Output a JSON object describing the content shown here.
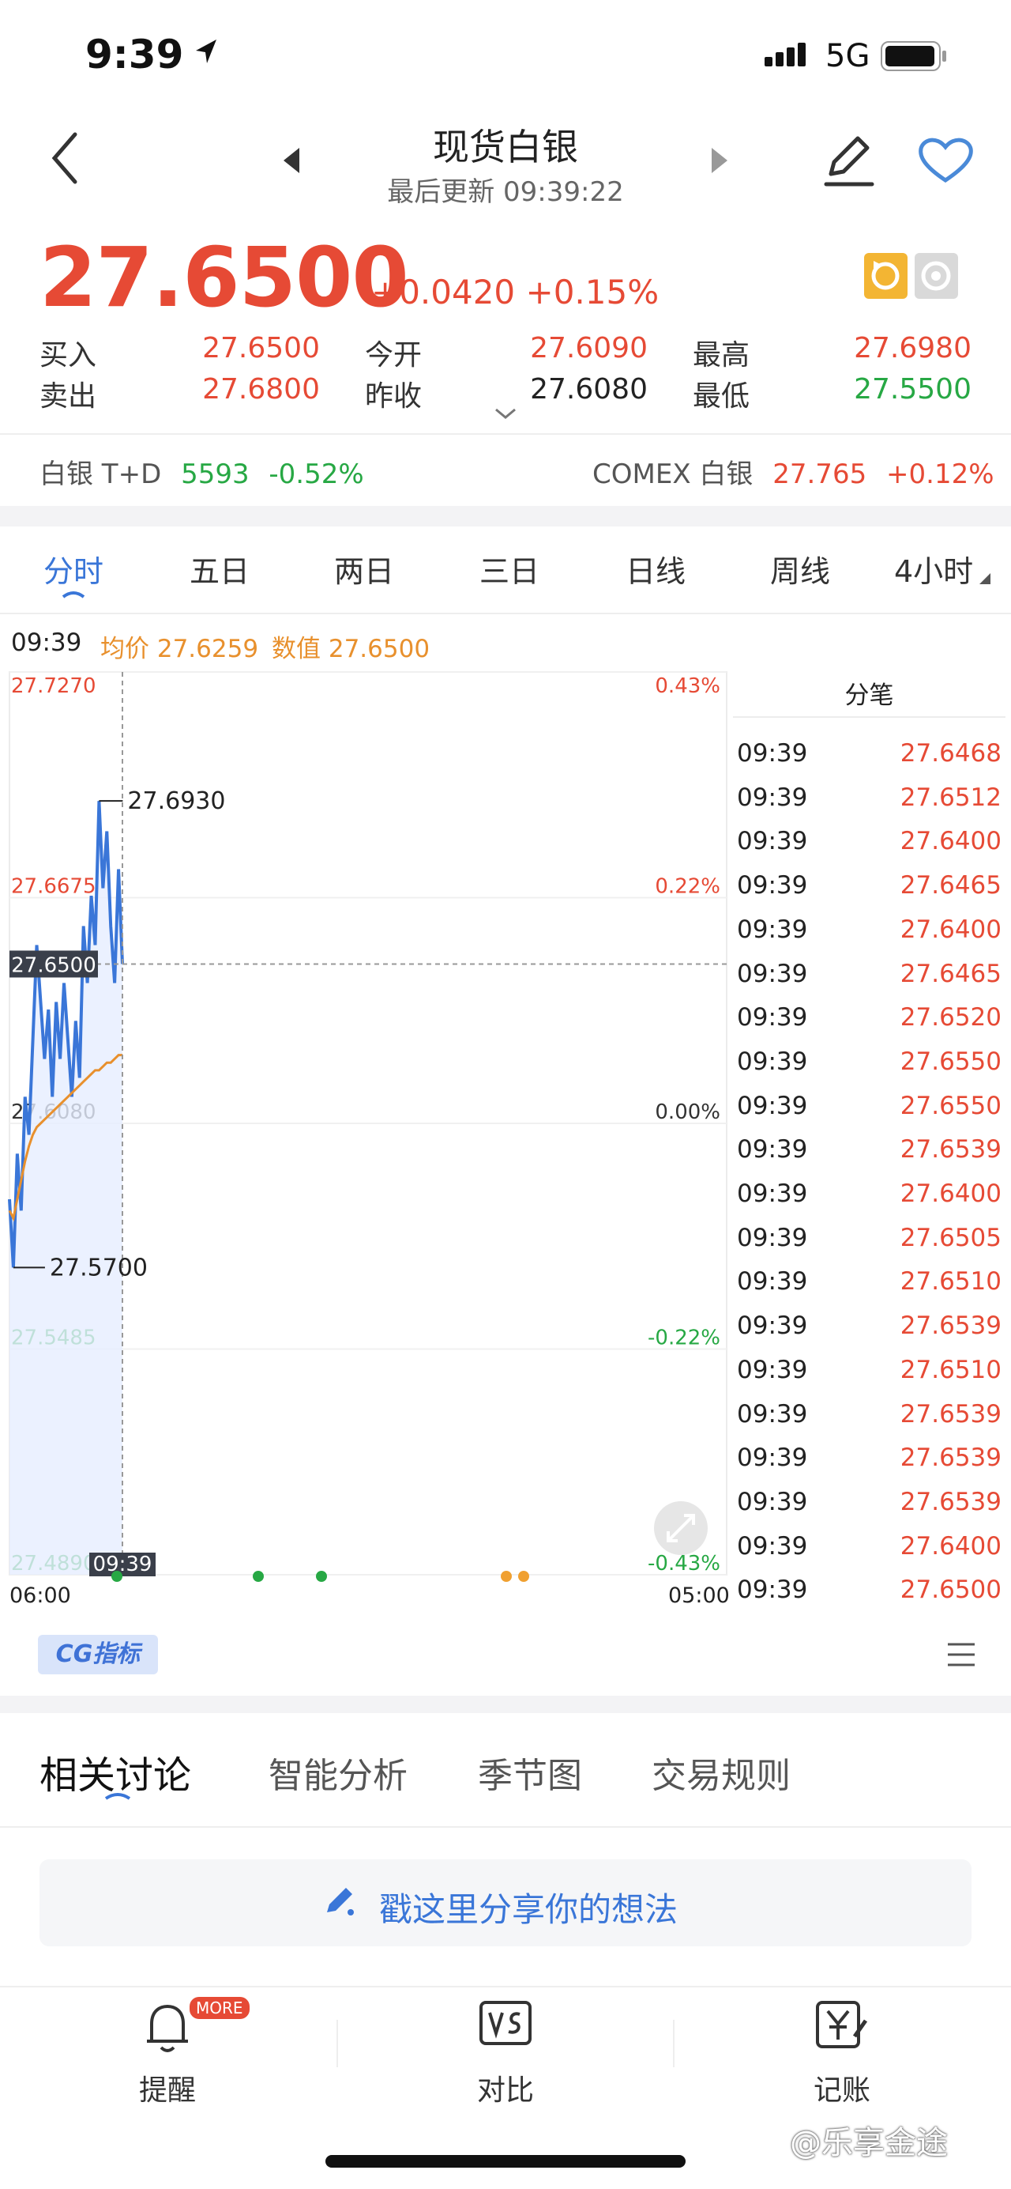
{
  "status_bar": {
    "time": "9:39",
    "network": "5G"
  },
  "header": {
    "title": "现货白银",
    "updated": "最后更新 09:39:22"
  },
  "quote": {
    "price": "27.6500",
    "change": "+0.0420 +0.15%",
    "rows": [
      [
        {
          "label": "买入",
          "value": "27.6500",
          "color": "red"
        },
        {
          "label": "今开",
          "value": "27.6090",
          "color": "red"
        },
        {
          "label": "最高",
          "value": "27.6980",
          "color": "red"
        }
      ],
      [
        {
          "label": "卖出",
          "value": "27.6800",
          "color": "red"
        },
        {
          "label": "昨收",
          "value": "27.6080",
          "color": "dark"
        },
        {
          "label": "最低",
          "value": "27.5500",
          "color": "green"
        }
      ]
    ]
  },
  "related": {
    "left": {
      "label": "白银 T+D",
      "price": "5593",
      "change": "-0.52%"
    },
    "right": {
      "label": "COMEX 白银",
      "price": "27.765",
      "change": "+0.12%"
    }
  },
  "tabs": [
    "分时",
    "五日",
    "两日",
    "三日",
    "日线",
    "周线",
    "4小时"
  ],
  "info_line": {
    "time": "09:39",
    "avg": "均价 27.6259",
    "value": "数值 27.6500"
  },
  "chart_data": {
    "type": "line",
    "y_labels_left": [
      "27.7270",
      "27.6675",
      "27.6080",
      "27.5485",
      "27.4890"
    ],
    "y_labels_right": [
      "0.43%",
      "0.22%",
      "0.00%",
      "-0.22%",
      "-0.43%"
    ],
    "ylim": [
      27.489,
      27.727
    ],
    "x_labels": [
      "06:00",
      "05:00"
    ],
    "current_label": "27.6500",
    "crosshair_time": "09:39",
    "max_label": "27.6930",
    "min_label": "27.5700",
    "series": [
      {
        "values": [
          27.588,
          27.57,
          27.6,
          27.585,
          27.615,
          27.605,
          27.63,
          27.655,
          27.64,
          27.625,
          27.638,
          27.615,
          27.64,
          27.625,
          27.645,
          27.63,
          27.615,
          27.635,
          27.62,
          27.66,
          27.645,
          27.668,
          27.655,
          27.693,
          27.67,
          27.685,
          27.66,
          27.645,
          27.675,
          27.65
        ]
      },
      {
        "values": [
          27.585,
          27.583,
          27.588,
          27.593,
          27.598,
          27.602,
          27.605,
          27.607,
          27.608,
          27.609,
          27.61,
          27.611,
          27.612,
          27.613,
          27.614,
          27.615,
          27.616,
          27.617,
          27.618,
          27.619,
          27.62,
          27.621,
          27.622,
          27.622,
          27.623,
          27.624,
          27.624,
          27.625,
          27.626,
          27.626
        ]
      }
    ]
  },
  "ticks": {
    "header": "分笔",
    "rows": [
      {
        "time": "09:39",
        "value": "27.6468"
      },
      {
        "time": "09:39",
        "value": "27.6512"
      },
      {
        "time": "09:39",
        "value": "27.6400"
      },
      {
        "time": "09:39",
        "value": "27.6465"
      },
      {
        "time": "09:39",
        "value": "27.6400"
      },
      {
        "time": "09:39",
        "value": "27.6465"
      },
      {
        "time": "09:39",
        "value": "27.6520"
      },
      {
        "time": "09:39",
        "value": "27.6550"
      },
      {
        "time": "09:39",
        "value": "27.6550"
      },
      {
        "time": "09:39",
        "value": "27.6539"
      },
      {
        "time": "09:39",
        "value": "27.6400"
      },
      {
        "time": "09:39",
        "value": "27.6505"
      },
      {
        "time": "09:39",
        "value": "27.6510"
      },
      {
        "time": "09:39",
        "value": "27.6539"
      },
      {
        "time": "09:39",
        "value": "27.6510"
      },
      {
        "time": "09:39",
        "value": "27.6539"
      },
      {
        "time": "09:39",
        "value": "27.6539"
      },
      {
        "time": "09:39",
        "value": "27.6539"
      },
      {
        "time": "09:39",
        "value": "27.6400"
      },
      {
        "time": "09:39",
        "value": "27.6500"
      }
    ]
  },
  "cg_label": "CG指标",
  "bottom_tabs": [
    "相关讨论",
    "智能分析",
    "季节图",
    "交易规则"
  ],
  "share_placeholder": "戳这里分享你的想法",
  "nav": {
    "alert": "提醒",
    "more_badge": "MORE",
    "compare": "对比",
    "ledger": "记账"
  },
  "watermark": "@乐享金途",
  "colors": {
    "up": "#e64a35",
    "down": "#27a844",
    "accent": "#3a76d8",
    "avg_line": "#e8902d"
  }
}
